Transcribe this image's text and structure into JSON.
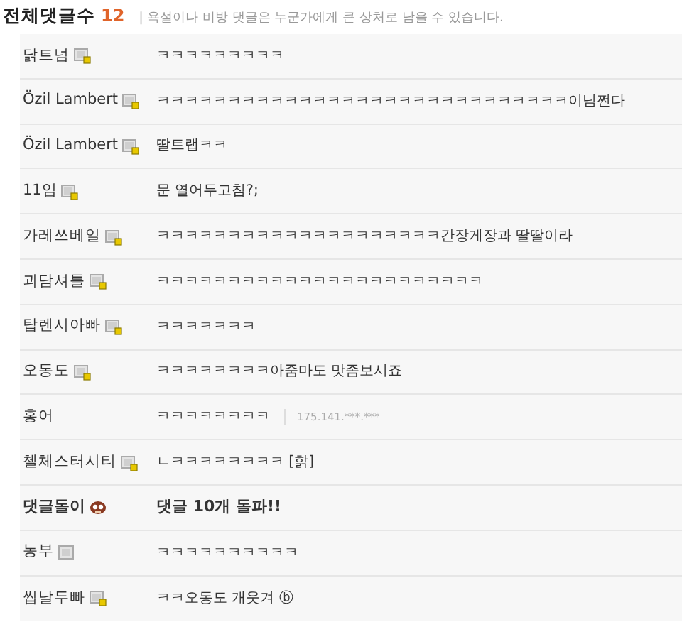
{
  "header": {
    "title": "전체댓글수",
    "count": "12",
    "notice": "| 욕설이나 비방 댓글은 누군가에게 큰 상처로 남을 수 있습니다."
  },
  "comments": [
    {
      "kind": "member",
      "nick": "닭트넘",
      "text": "ㅋㅋㅋㅋㅋㅋㅋㅋㅋ"
    },
    {
      "kind": "member",
      "nick": "Özil Lambert",
      "text": "ㅋㅋㅋㅋㅋㅋㅋㅋㅋㅋㅋㅋㅋㅋㅋㅋㅋㅋㅋㅋㅋㅋㅋㅋㅋㅋㅋㅋㅋ이님쩐다"
    },
    {
      "kind": "member",
      "nick": "Özil Lambert",
      "text": "딸트랩ㅋㅋ"
    },
    {
      "kind": "member",
      "nick": "11임",
      "text": "문 열어두고침?;"
    },
    {
      "kind": "member",
      "nick": "가레쓰베일",
      "text": "ㅋㅋㅋㅋㅋㅋㅋㅋㅋㅋㅋㅋㅋㅋㅋㅋㅋㅋㅋㅋ간장게장과 딸딸이라"
    },
    {
      "kind": "member",
      "nick": "괴담셔틀",
      "text": "ㅋㅋㅋㅋㅋㅋㅋㅋㅋㅋㅋㅋㅋㅋㅋㅋㅋㅋㅋㅋㅋㅋㅋ"
    },
    {
      "kind": "member",
      "nick": "탑렌시아빠",
      "text": "ㅋㅋㅋㅋㅋㅋㅋ"
    },
    {
      "kind": "member",
      "nick": "오동도",
      "text": "ㅋㅋㅋㅋㅋㅋㅋㅋ아줌마도 맛좀보시죠"
    },
    {
      "kind": "guest",
      "nick": "홍어",
      "text": "ㅋㅋㅋㅋㅋㅋㅋㅋ",
      "ip": "175.141.***.***"
    },
    {
      "kind": "member",
      "nick": "첼체스터시티",
      "text": "ㄴㅋㅋㅋㅋㅋㅋㅋㅋ [핡]"
    },
    {
      "kind": "bot",
      "nick": "댓글돌이",
      "text": "댓글 10개 돌파!!"
    },
    {
      "kind": "plain",
      "nick": "농부",
      "text": "ㅋㅋㅋㅋㅋㅋㅋㅋㅋㅋ"
    },
    {
      "kind": "member",
      "nick": "씹날두빠",
      "text": "ㅋㅋ오동도 개웃겨 ⓑ"
    }
  ]
}
